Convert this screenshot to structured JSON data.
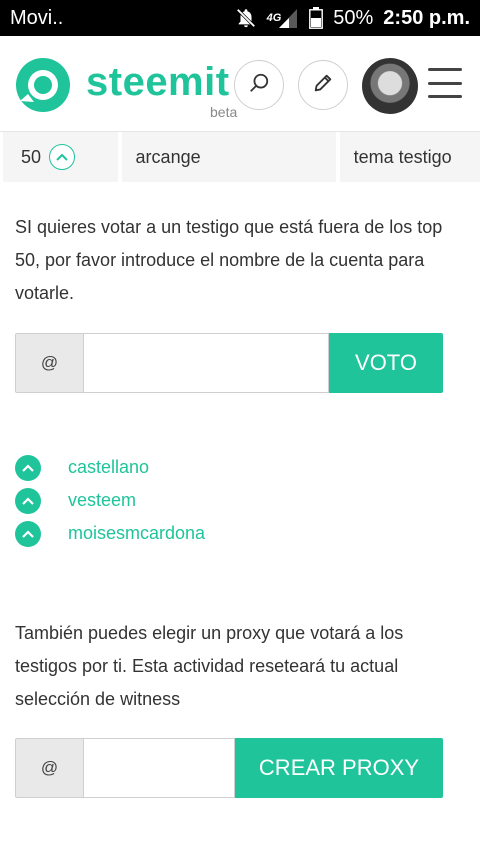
{
  "statusbar": {
    "carrier": "Movi..",
    "network": "4G",
    "battery": "50%",
    "time": "2:50 p.m.",
    "icons": [
      "notifications-off-icon",
      "signal-icon",
      "battery-icon"
    ]
  },
  "header": {
    "brand": "steemit",
    "beta": "beta",
    "icons": [
      "steemit-logo-icon",
      "search-icon",
      "pencil-icon",
      "avatar",
      "hamburger-menu-icon"
    ]
  },
  "witness_table_row": {
    "rank": "50",
    "name": "arcange",
    "description": "tema testigo"
  },
  "vote_section": {
    "description": "SI quieres votar a un testigo que está fuera de los top 50, por favor introduce el nombre de la cuenta para votarle.",
    "prefix": "@",
    "input_value": "",
    "input_placeholder": "",
    "button_label": "VOTO"
  },
  "voted_witnesses": [
    {
      "name": "castellano"
    },
    {
      "name": "vesteem"
    },
    {
      "name": "moisesmcardona"
    }
  ],
  "proxy_section": {
    "description": "También puedes elegir un proxy que votará a los testigos por ti. Esta actividad reseteará tu actual selección de witness",
    "prefix": "@",
    "input_value": "",
    "input_placeholder": "",
    "button_label": "CREAR PROXY"
  },
  "colors": {
    "accent": "#1fc49b",
    "text": "#333333",
    "cell_bg": "#f5f5f5"
  }
}
